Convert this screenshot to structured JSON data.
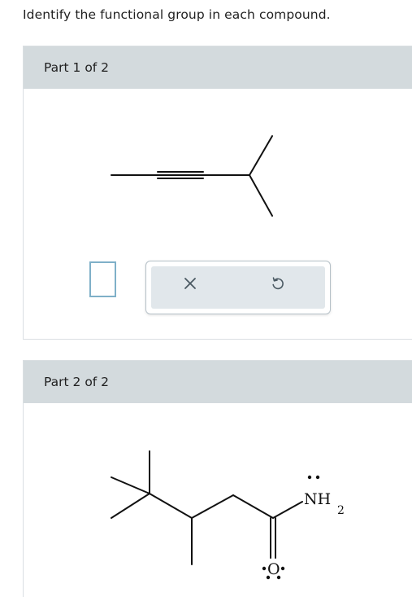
{
  "instruction": "Identify the functional group in each compound.",
  "parts": [
    {
      "label": "Part 1 of 2"
    },
    {
      "label": "Part 2 of 2"
    }
  ],
  "toolbar": {
    "clear_icon": "x-icon",
    "undo_icon": "undo-icon"
  },
  "molecule2": {
    "oxygen_label": "O",
    "amine_label": "NH",
    "amine_subscript": "2"
  },
  "colors": {
    "header_bg": "#d3dadd",
    "answer_box_border": "#7fb0c8",
    "tool_bg": "#e1e7eb"
  }
}
